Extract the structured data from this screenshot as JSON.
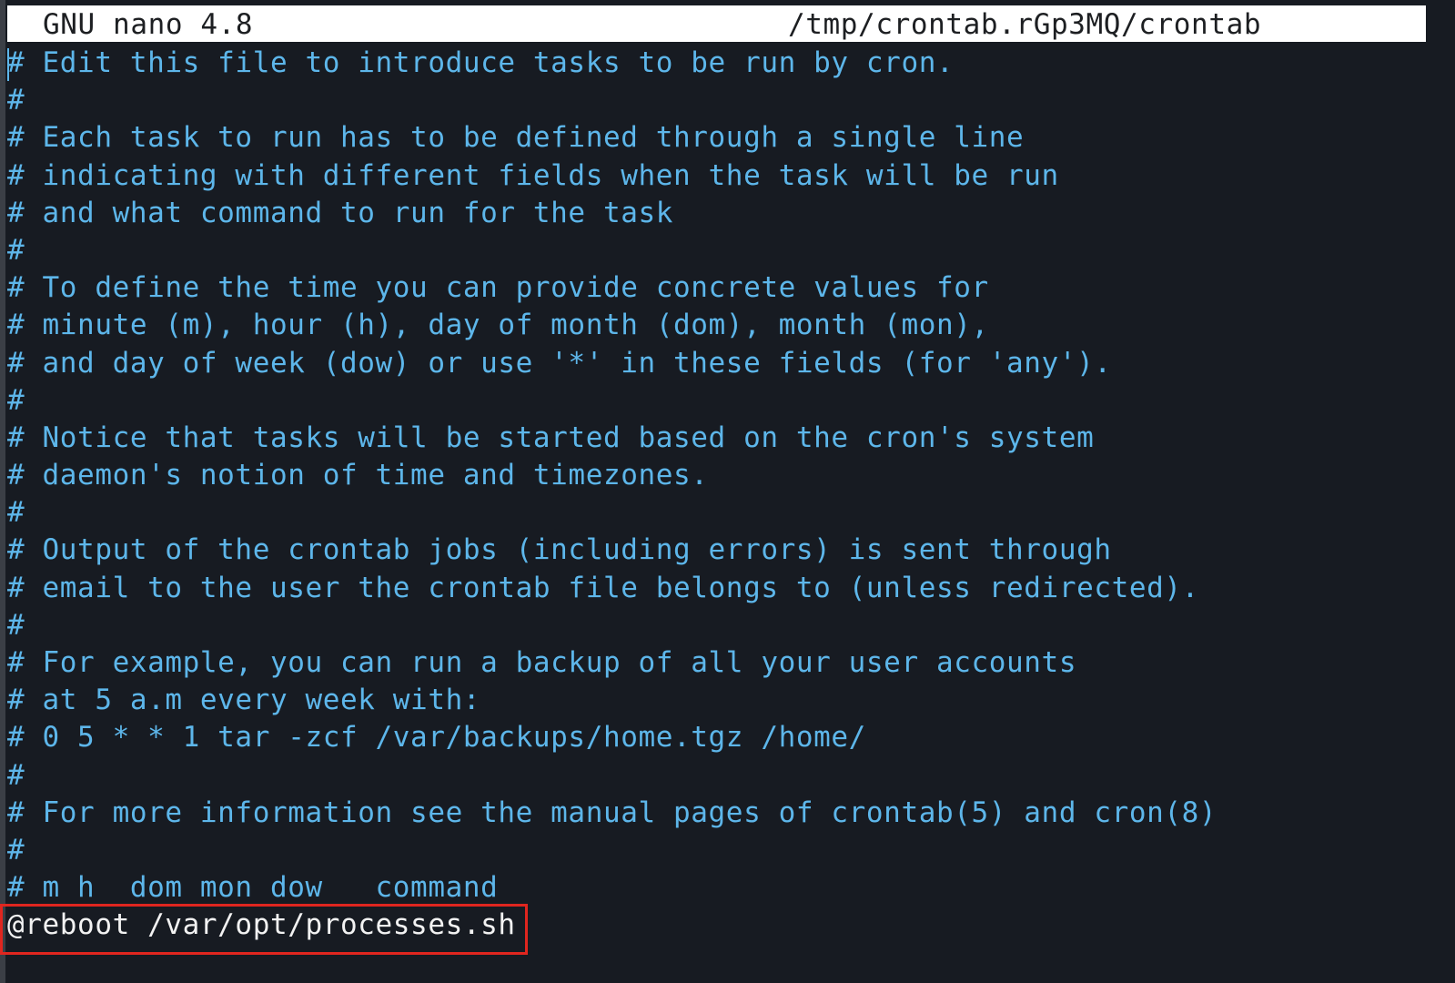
{
  "titlebar": {
    "app": "GNU nano 4.8",
    "file": "/tmp/crontab.rGp3MQ/crontab"
  },
  "lines": [
    "# Edit this file to introduce tasks to be run by cron.",
    "#",
    "# Each task to run has to be defined through a single line",
    "# indicating with different fields when the task will be run",
    "# and what command to run for the task",
    "#",
    "# To define the time you can provide concrete values for",
    "# minute (m), hour (h), day of month (dom), month (mon),",
    "# and day of week (dow) or use '*' in these fields (for 'any').",
    "#",
    "# Notice that tasks will be started based on the cron's system",
    "# daemon's notion of time and timezones.",
    "#",
    "# Output of the crontab jobs (including errors) is sent through",
    "# email to the user the crontab file belongs to (unless redirected).",
    "#",
    "# For example, you can run a backup of all your user accounts",
    "# at 5 a.m every week with:",
    "# 0 5 * * 1 tar -zcf /var/backups/home.tgz /home/",
    "#",
    "# For more information see the manual pages of crontab(5) and cron(8)",
    "#",
    "# m h  dom mon dow   command"
  ],
  "entry": "@reboot /var/opt/processes.sh",
  "colors": {
    "background": "#171b22",
    "comment": "#5db6ea",
    "entry_text": "#f2f2f2",
    "titlebar_bg": "#ffffff",
    "highlight": "#e0261f"
  }
}
